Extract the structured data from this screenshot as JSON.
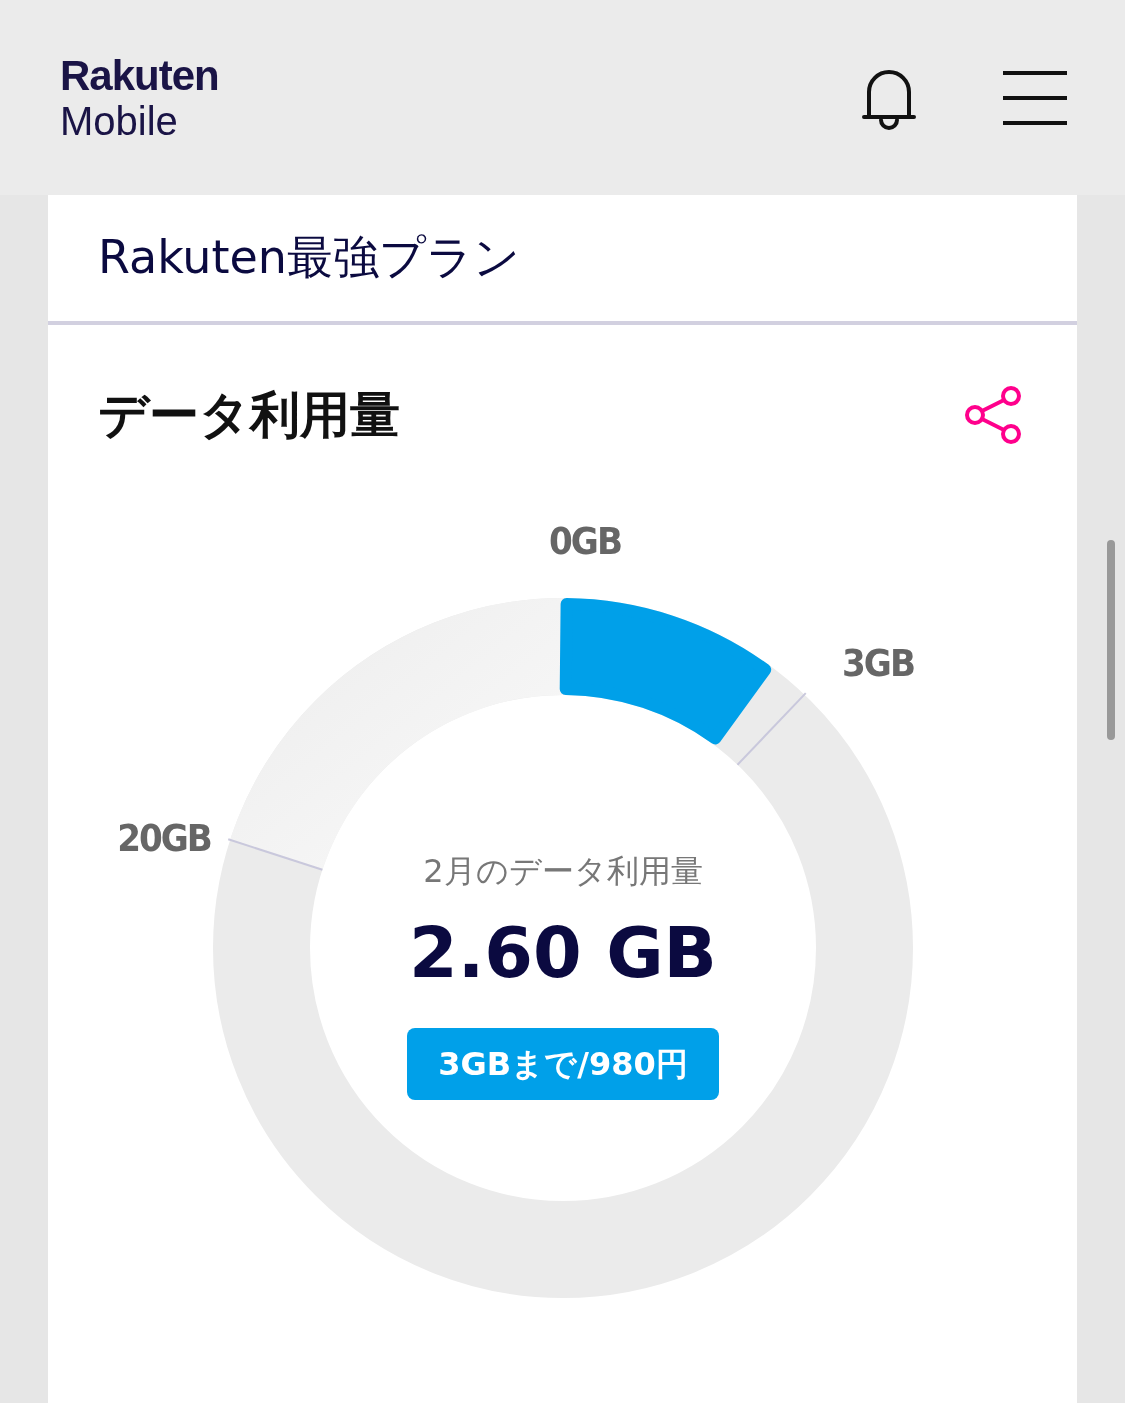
{
  "header": {
    "logo_top": "Rakuten",
    "logo_bottom": "Mobile"
  },
  "plan": {
    "name": "Rakuten最強プラン"
  },
  "usage": {
    "title": "データ利用量",
    "gauge": {
      "labels": [
        "0GB",
        "3GB",
        "20GB"
      ],
      "caption": "2月のデータ利用量",
      "value": "2.60 GB",
      "badge": "3GBまで/980円"
    }
  }
}
